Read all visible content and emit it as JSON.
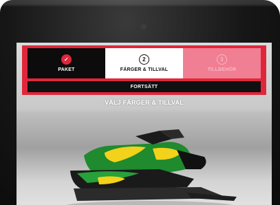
{
  "steps": [
    {
      "badge": "✓",
      "label": "PAKET"
    },
    {
      "badge": "2",
      "label": "FÄRGER & TILLVAL"
    },
    {
      "badge": "3",
      "label": "TILLBEHÖR"
    }
  ],
  "continue_label": "FORTSÄTT",
  "section_title": "VÄLJ FÄRGER & TILLVAL",
  "colors": {
    "accent_red": "#e0263b",
    "step_done_bg": "#0c0c0c",
    "step_future_bg": "#f07f93"
  }
}
